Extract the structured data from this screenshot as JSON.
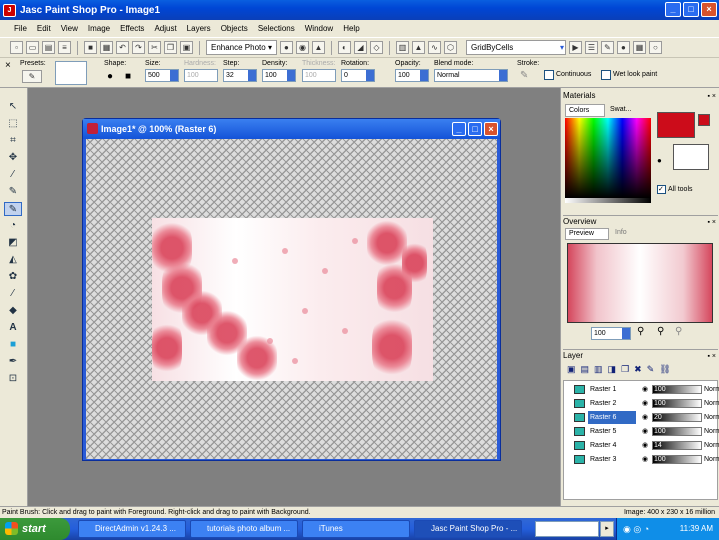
{
  "app": {
    "title": "Jasc Paint Shop Pro - Image1"
  },
  "menu": [
    "File",
    "Edit",
    "View",
    "Image",
    "Effects",
    "Adjust",
    "Layers",
    "Objects",
    "Selections",
    "Window",
    "Help"
  ],
  "toolbar": {
    "enhance_photo": "Enhance Photo",
    "grid_select": "GridByCells"
  },
  "tool_options": {
    "presets_label": "Presets:",
    "shape_label": "Shape:",
    "size_label": "Size:",
    "size_value": "500",
    "hardness_label": "Hardness:",
    "hardness_value": "100",
    "step_label": "Step:",
    "step_value": "32",
    "density_label": "Density:",
    "density_value": "100",
    "thickness_label": "Thickness:",
    "thickness_value": "100",
    "rotation_label": "Rotation:",
    "rotation_value": "0",
    "opacity_label": "Opacity:",
    "opacity_value": "100",
    "blend_label": "Blend mode:",
    "blend_value": "Normal",
    "stroke_label": "Stroke:",
    "continuous_label": "Continuous",
    "wet_label": "Wet look paint"
  },
  "image_window": {
    "title": "Image1* @ 100% (Raster 6)"
  },
  "materials": {
    "title": "Materials",
    "tab_colors": "Colors",
    "tab_swatches": "Swat...",
    "all_tools": "All tools"
  },
  "overview": {
    "title": "Overview",
    "tab_preview": "Preview",
    "tab_info": "Info",
    "zoom_value": "100"
  },
  "layers": {
    "title": "Layer",
    "rows": [
      {
        "name": "Raster 1",
        "opacity": "100",
        "blend": "Norm",
        "selected": false
      },
      {
        "name": "Raster 2",
        "opacity": "100",
        "blend": "Norm",
        "selected": false
      },
      {
        "name": "Raster 6",
        "opacity": "20",
        "blend": "Norm",
        "selected": true
      },
      {
        "name": "Raster 5",
        "opacity": "100",
        "blend": "Norm",
        "selected": false
      },
      {
        "name": "Raster 4",
        "opacity": "14",
        "blend": "Norm",
        "selected": false
      },
      {
        "name": "Raster 3",
        "opacity": "100",
        "blend": "Norm",
        "selected": false
      }
    ]
  },
  "status": {
    "hint": "Paint Brush: Click and drag to paint with Foreground. Right-click and drag to paint with Background.",
    "image_info": "Image: 400 x 230 x 16 million"
  },
  "taskbar": {
    "start": "start",
    "tasks": [
      "DirectAdmin v1.24.3 ...",
      "tutorials photo album ...",
      "iTunes",
      "Jasc Paint Shop Pro - ..."
    ],
    "clock": "11:39 AM"
  },
  "colors": {
    "foreground": "#cc0c1a",
    "background": "#ffffff"
  }
}
